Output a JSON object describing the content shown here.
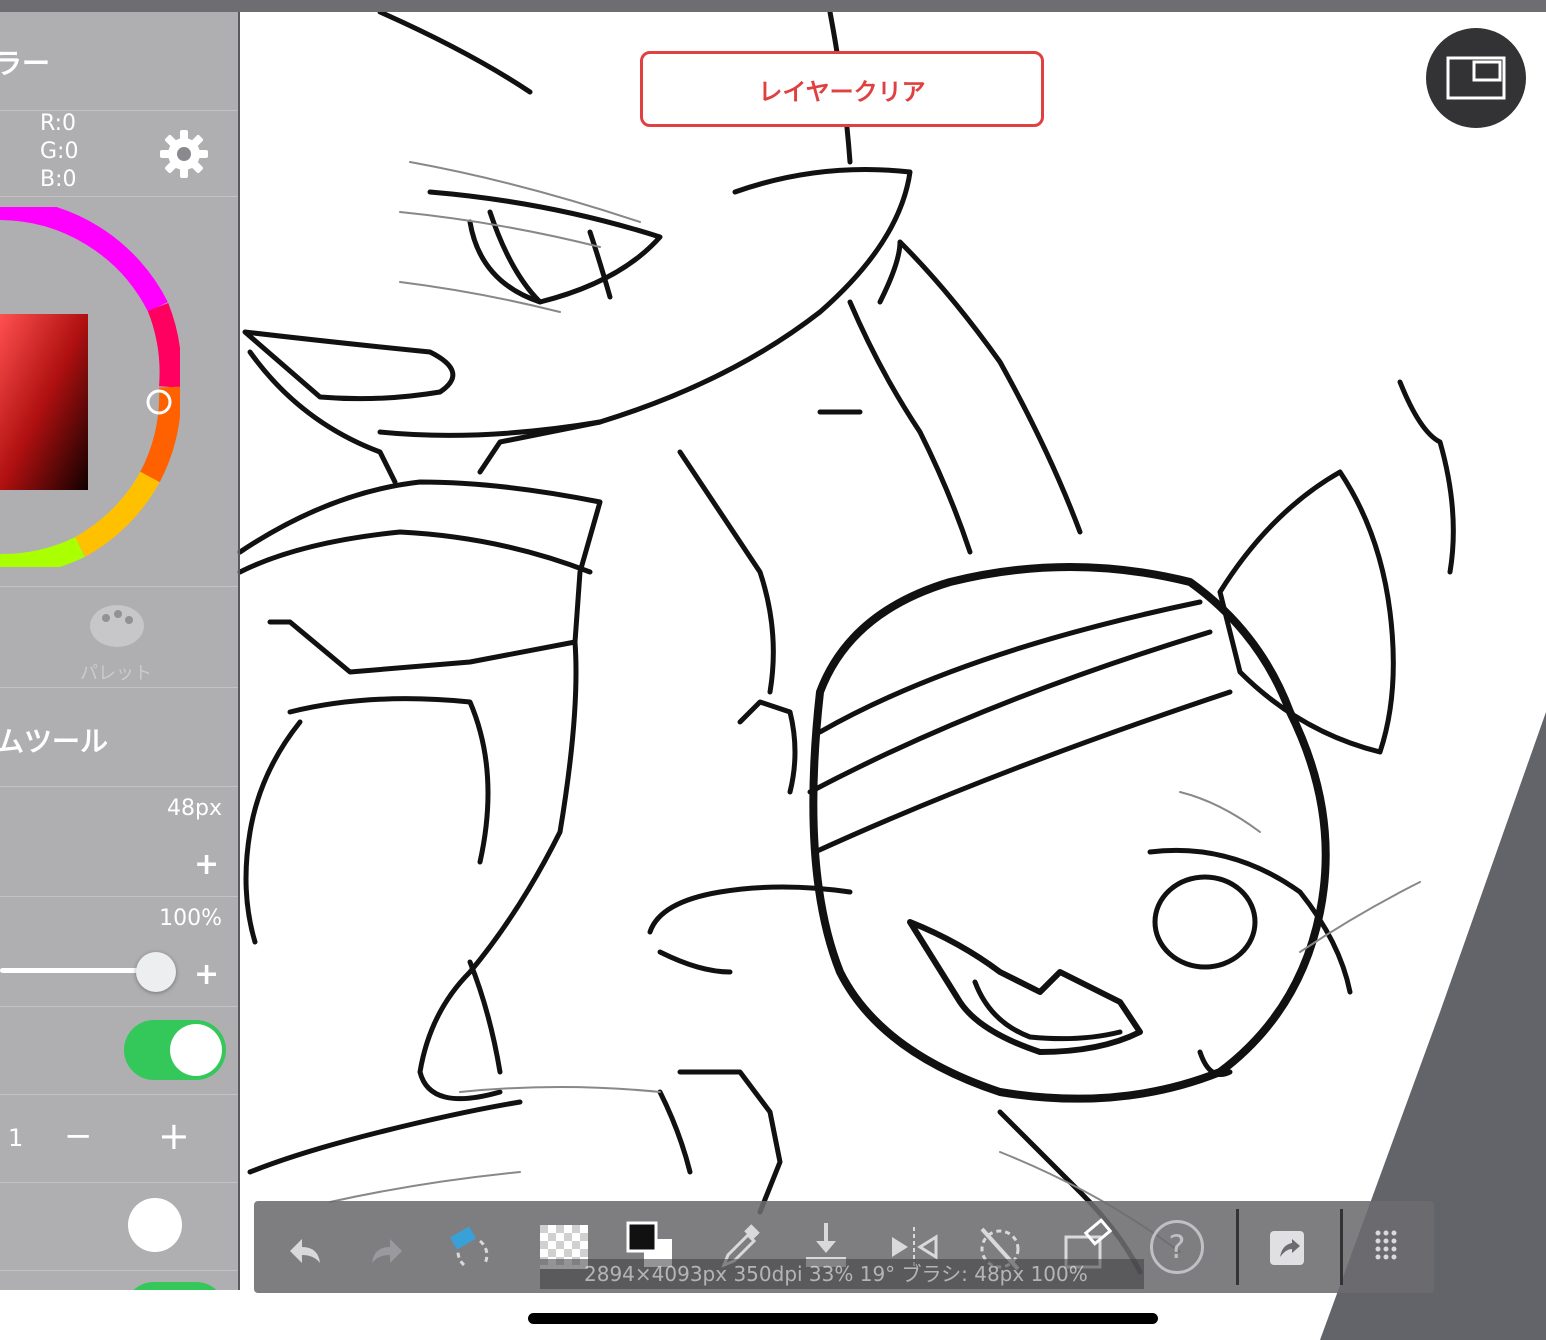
{
  "panel": {
    "title": "ラー",
    "rgb": {
      "r": "R:0",
      "g": "G:0",
      "b": "B:0"
    },
    "palette_label": "パレット",
    "tool_title": "ムツール",
    "brush_size": "48px",
    "opacity": "100%",
    "opacity_level": 1.0,
    "toggle_on": true,
    "stepper_value": "1",
    "plus_label": "+",
    "minus_label": "−"
  },
  "canvas": {
    "clear_button_label": "レイヤークリア"
  },
  "toolbar": {
    "status": "2894×4093px 350dpi 33% 19° ブラシ: 48px 100%",
    "help_label": "?"
  },
  "colors": {
    "accent_red": "#e04040",
    "toggle_green": "#34c759",
    "panel_grey": "#6e6e72"
  }
}
